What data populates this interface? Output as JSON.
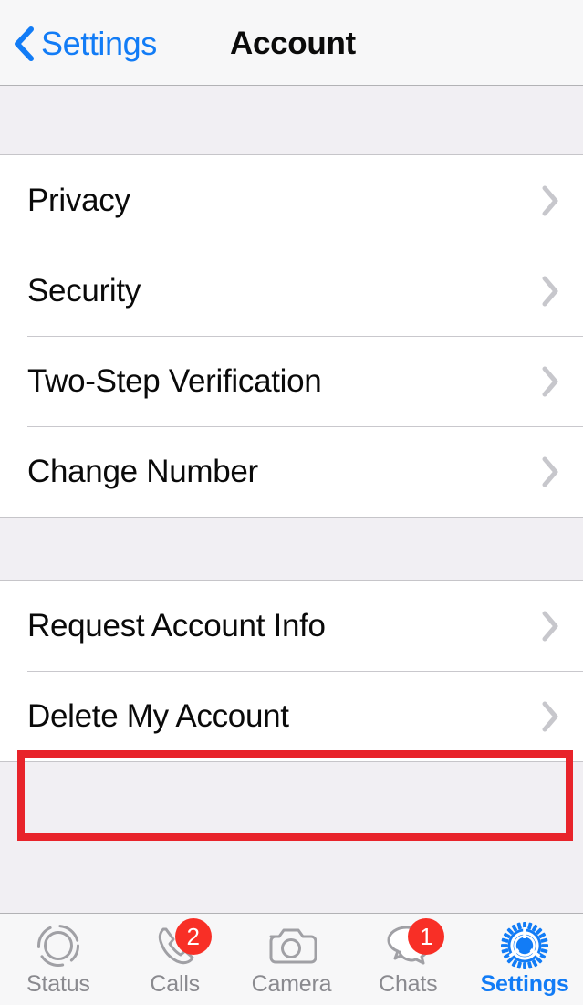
{
  "navbar": {
    "back_label": "Settings",
    "back_icon": "chevron-left-icon",
    "title": "Account"
  },
  "colors": {
    "accent_blue": "#127cf6",
    "badge_red": "#f82f26",
    "annotation_red": "#e8232a",
    "row_background": "#ffffff",
    "group_gap": "#f1eff3",
    "chevron_gray": "#c7c7cc",
    "tab_inactive": "#8a8a8f"
  },
  "sections": [
    {
      "name": "account-settings-group",
      "rows": [
        {
          "label": "Privacy",
          "accessory": "chevron-right-icon"
        },
        {
          "label": "Security",
          "accessory": "chevron-right-icon"
        },
        {
          "label": "Two-Step Verification",
          "accessory": "chevron-right-icon"
        },
        {
          "label": "Change Number",
          "accessory": "chevron-right-icon"
        }
      ]
    },
    {
      "name": "account-data-group",
      "rows": [
        {
          "label": "Request Account Info",
          "accessory": "chevron-right-icon"
        },
        {
          "label": "Delete My Account",
          "accessory": "chevron-right-icon",
          "highlighted": true
        }
      ]
    }
  ],
  "annotation": {
    "target_label": "Delete My Account",
    "shape": "rectangle",
    "color": "#e8232a"
  },
  "tabbar": {
    "tabs": [
      {
        "label": "Status",
        "icon": "status-ring-icon",
        "badge": null,
        "active": false
      },
      {
        "label": "Calls",
        "icon": "phone-icon",
        "badge": "2",
        "active": false
      },
      {
        "label": "Camera",
        "icon": "camera-icon",
        "badge": null,
        "active": false
      },
      {
        "label": "Chats",
        "icon": "chat-bubbles-icon",
        "badge": "1",
        "active": false
      },
      {
        "label": "Settings",
        "icon": "gear-icon",
        "badge": null,
        "active": true
      }
    ]
  }
}
